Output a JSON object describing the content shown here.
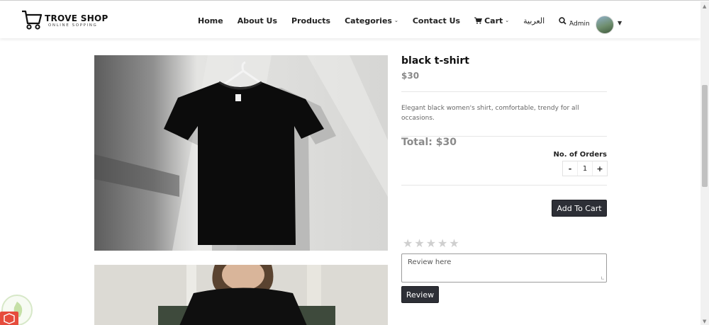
{
  "brand": {
    "name": "TROVE SHOP",
    "tagline": "ONLINE SOPPING"
  },
  "nav": [
    {
      "label": "Home",
      "dropdown": false
    },
    {
      "label": "About Us",
      "dropdown": false
    },
    {
      "label": "Products",
      "dropdown": false
    },
    {
      "label": "Categories",
      "dropdown": true
    },
    {
      "label": "Contact Us",
      "dropdown": false
    },
    {
      "label": "Cart",
      "dropdown": true,
      "icon": "shopping-cart-icon"
    },
    {
      "label": "العربية",
      "dropdown": false
    },
    {
      "label": "",
      "dropdown": true,
      "icon": "search-icon"
    }
  ],
  "user": {
    "name": "Admin"
  },
  "product": {
    "name": "black t-shirt",
    "price": "$30",
    "description": "Elegant black women's shirt, comfortable, trendy for all occasions.",
    "total": "Total: $30",
    "orders_label": "No. of Orders",
    "quantity": "1",
    "decrement": "-",
    "increment": "+",
    "add_to_cart": "Add To Cart"
  },
  "review": {
    "rating": 0,
    "max_rating": 5,
    "placeholder": "Review here",
    "submit": "Review"
  },
  "colors": {
    "button_dark": "#2d2f36",
    "price_gray": "#888888",
    "star_empty": "#cfcfcf"
  }
}
